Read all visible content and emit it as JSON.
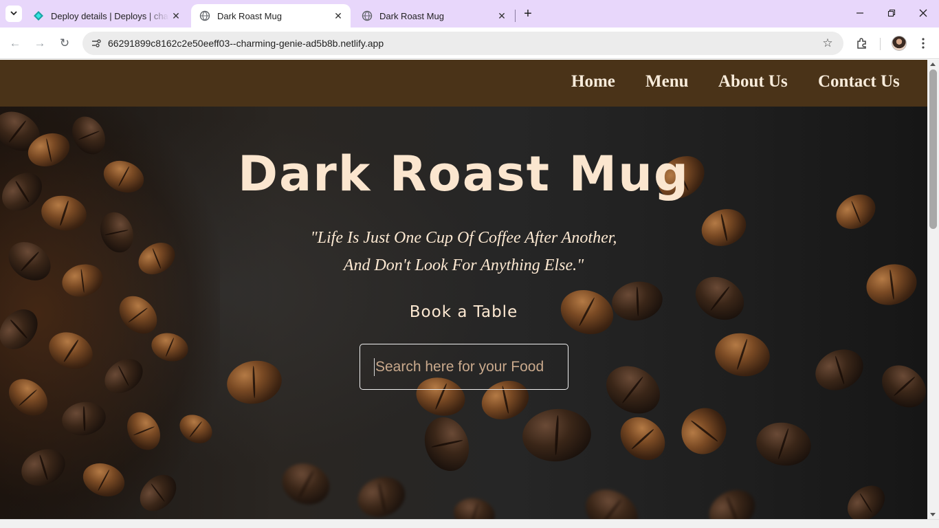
{
  "browser": {
    "tabs": [
      {
        "title": "Deploy details | Deploys | charming-genie",
        "favicon": "netlify-icon",
        "active": false
      },
      {
        "title": "Dark Roast Mug",
        "favicon": "globe-icon",
        "active": true
      },
      {
        "title": "Dark Roast Mug",
        "favicon": "globe-icon",
        "active": false
      }
    ],
    "url": "66291899c8162c2e50eeff03--charming-genie-ad5b8b.netlify.app",
    "accent_color": "#e8d7fb"
  },
  "site": {
    "nav": [
      {
        "label": "Home"
      },
      {
        "label": "Menu"
      },
      {
        "label": "About Us"
      },
      {
        "label": "Contact Us"
      }
    ],
    "header_color": "#4a3318",
    "hero": {
      "title": "Dark Roast Mug",
      "quote_line1": "\"Life Is Just One Cup Of Coffee After Another,",
      "quote_line2": "And Don't Look For Anything Else.\"",
      "book_label": "Book a Table",
      "search_placeholder": "Search here for your Food",
      "search_value": ""
    }
  }
}
